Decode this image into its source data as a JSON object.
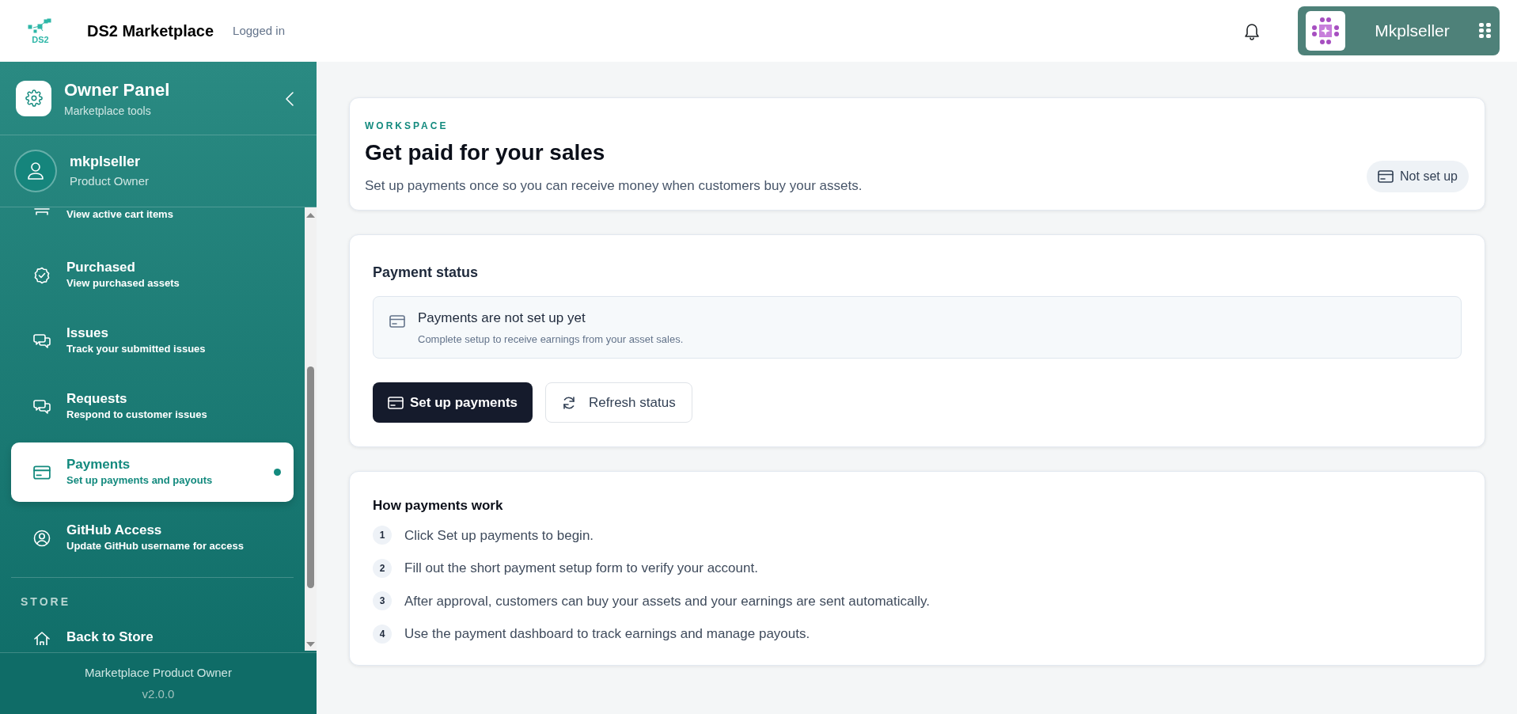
{
  "header": {
    "brand": "DS2 Marketplace",
    "logo_text": "DS2",
    "status": "Logged in",
    "user_button": {
      "label": "Mkplseller"
    }
  },
  "sidebar": {
    "title": "Owner Panel",
    "subtitle": "Marketplace tools",
    "user": {
      "name": "mkplseller",
      "role": "Product Owner"
    },
    "items": [
      {
        "subtitle": "View active cart items",
        "selected": false
      },
      {
        "title": "Purchased",
        "subtitle": "View purchased assets",
        "selected": false
      },
      {
        "title": "Issues",
        "subtitle": "Track your submitted issues",
        "selected": false
      },
      {
        "title": "Requests",
        "subtitle": "Respond to customer issues",
        "selected": false
      },
      {
        "title": "Payments",
        "subtitle": "Set up payments and payouts",
        "selected": true
      },
      {
        "title": "GitHub Access",
        "subtitle": "Update GitHub username for access",
        "selected": false
      }
    ],
    "section_label": "STORE",
    "store_items": [
      {
        "title": "Back to Store"
      }
    ],
    "footer": {
      "title": "Marketplace Product Owner",
      "version": "v2.0.0"
    }
  },
  "page_header": {
    "eyebrow": "WORKSPACE",
    "title": "Get paid for your sales",
    "description": "Set up payments once so you can receive money when customers buy your assets.",
    "status_badge": "Not set up"
  },
  "payment_status": {
    "title": "Payment status",
    "alert": {
      "title": "Payments are not set up yet",
      "text": "Complete setup to receive earnings from your asset sales."
    },
    "buttons": [
      {
        "label": "Set up payments",
        "kind": "primary"
      },
      {
        "label": "Refresh status",
        "kind": "secondary"
      }
    ]
  },
  "how_it_works": {
    "title": "How payments work",
    "steps": [
      {
        "number": "1",
        "text": "Click Set up payments to begin."
      },
      {
        "number": "2",
        "text": "Fill out the short payment setup form to verify your account."
      },
      {
        "number": "3",
        "text": "After approval, customers can buy your assets and your earnings are sent automatically."
      },
      {
        "number": "4",
        "text": "Use the payment dashboard to track earnings and manage payouts."
      }
    ]
  }
}
